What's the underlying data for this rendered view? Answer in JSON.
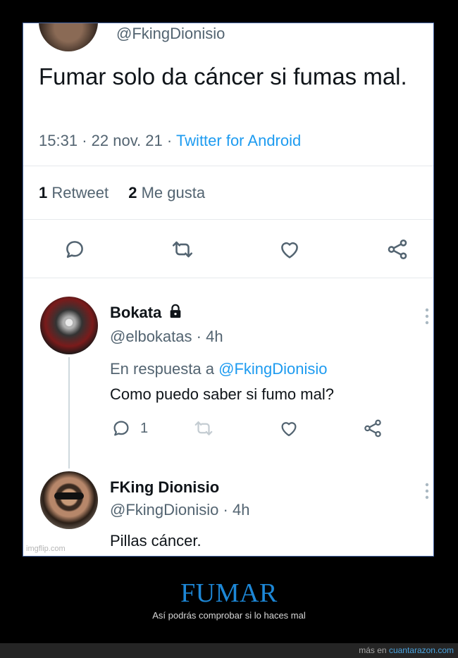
{
  "tweet": {
    "handle": "@FkingDionisio",
    "text": "Fumar solo da cáncer si fumas mal.",
    "time": "15:31",
    "date": "22 nov. 21",
    "source": "Twitter for Android",
    "retweets_count": "1",
    "retweets_label": "Retweet",
    "likes_count": "2",
    "likes_label": "Me gusta",
    "sep": "·"
  },
  "reply1": {
    "name": "Bokata",
    "handle": "@elbokatas",
    "age": "4h",
    "reply_to_label": "En respuesta a",
    "reply_to_handle": "@FkingDionisio",
    "text": "Como puedo saber si fumo mal?",
    "reply_count": "1"
  },
  "reply2": {
    "name": "FKing Dionisio",
    "handle": "@FkingDionisio",
    "age": "4h",
    "text": "Pillas cáncer."
  },
  "watermark": "imgflip.com",
  "caption": {
    "title": "FUMAR",
    "subtitle": "Así podrás comprobar si lo haces mal"
  },
  "footer": {
    "prefix": "más en",
    "site": "cuantarazon.com"
  },
  "colors": {
    "accent_blue": "#1d9bf0",
    "caption_blue": "#1d87d6",
    "text_gray": "#536471",
    "border": "#4a6aa8"
  }
}
